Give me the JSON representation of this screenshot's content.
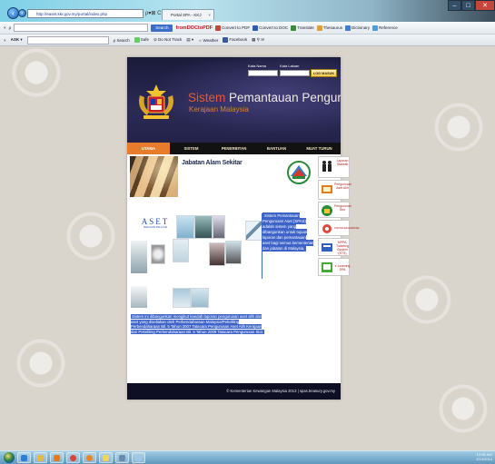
{
  "browser": {
    "address": "http://easet.kkr.gov.my/portal/index.php",
    "tab_title": "Portal SPA - KKJ",
    "search_button": "Search",
    "toolbar_items": [
      "Convert to PDF",
      "Convert to DOC",
      "Translate",
      "Thesaurus",
      "Dictionary",
      "Reference"
    ],
    "ask_label": "ASK",
    "links": [
      "Search",
      "Safe",
      "Do Not Track",
      "Weather",
      "Facebook"
    ]
  },
  "header": {
    "title_part1": "Sistem",
    "title_part2": " Pemantauan Pengurusan Aset",
    "subtitle": "Kerajaan Malaysia",
    "username_label": "Kata Nama",
    "password_label": "Kata Laluan",
    "login_button": "LOG MASUK"
  },
  "nav": {
    "items": [
      "UTAMA",
      "SISTEM",
      "PENERBITAN",
      "BANTUAN",
      "MUAT TURUN"
    ],
    "active_index": 0
  },
  "main": {
    "dept_title": "Jabatan Alam Sekitar",
    "aset_logo": "ASET",
    "aset_tagline": "KERAJAAN MALAYSIA",
    "intro_text": "Sistem Pemantauan Pengurusan Aset (SPAS) adalah sistem yang dibangunkan untuk tujuan laporan dan pemantauan aset bagi semua kementerian dan jabatan di Malaysia.",
    "bottom_text": "Sistem ini dibangunkan mengikut kaedah laporan pengurusan aset alih dan aset yang diseliakan oleh Perbendaharaan Malaysia/Pekeliling Perbendaharaan Bil. 5 Tahun 2007 Tatacara Pengurusan Aset Alih Kerajaan dan Pekeliling Perbendaharaan Bil. 5 Tahun 2009 Tatacara Pengurusan Stor."
  },
  "sidebar": {
    "items": [
      {
        "label": "Laporan Statistik"
      },
      {
        "label": "Pengurusan Aset Alih"
      },
      {
        "label": "Pengurusan Stor"
      },
      {
        "label": "KNOWLEDGEBASE"
      },
      {
        "label": "MPPA, Ticketing System (KTS)"
      },
      {
        "label": "e-Learning SPA"
      }
    ]
  },
  "footer": {
    "text": "© Kementerian Kewangan Malaysia 2013 | spas.treasury.gov.my"
  },
  "taskbar": {
    "time": "12:05 AM",
    "date": "2/13/2014"
  },
  "colors": {
    "nav_active": "#e87c2d",
    "title_red": "#e05a3a",
    "highlight_blue": "#3d63c8"
  }
}
